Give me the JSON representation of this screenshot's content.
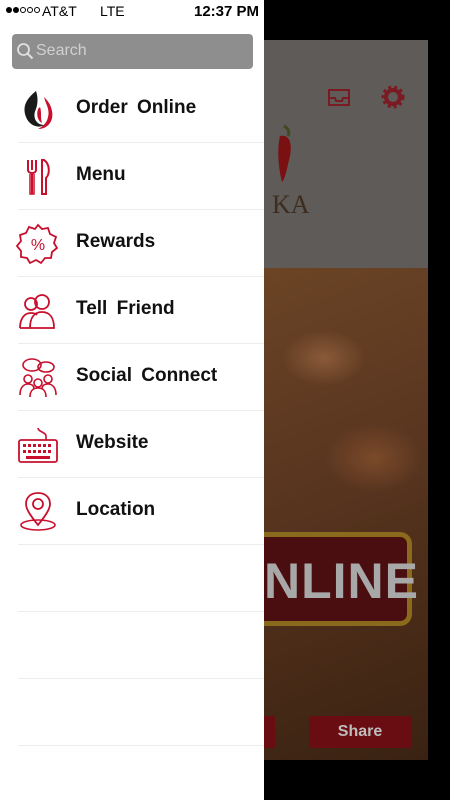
{
  "status_bar": {
    "carrier": "AT&T",
    "network": "LTE",
    "time": "12:37 PM",
    "signal_bars_filled": 2,
    "signal_bars_total": 5
  },
  "search": {
    "placeholder": "Search"
  },
  "menu": {
    "items": [
      {
        "label": "Order  Online",
        "icon": "flame-icon"
      },
      {
        "label": "Menu",
        "icon": "fork-knife-icon"
      },
      {
        "label": "Rewards",
        "icon": "percent-badge-icon"
      },
      {
        "label": "Tell  Friend",
        "icon": "users-icon"
      },
      {
        "label": "Social  Connect",
        "icon": "social-chat-icon"
      },
      {
        "label": "Website",
        "icon": "keyboard-icon"
      },
      {
        "label": "Location",
        "icon": "map-pin-icon"
      }
    ]
  },
  "background_app": {
    "order_banner_text": "NLINE",
    "share_button": "Share",
    "logo_partial": "KA",
    "icons": [
      "inbox-icon",
      "gear-icon"
    ]
  },
  "colors": {
    "accent_red": "#c8102e",
    "drawer_bg": "#ffffff",
    "search_bg": "#8e8e8e"
  }
}
